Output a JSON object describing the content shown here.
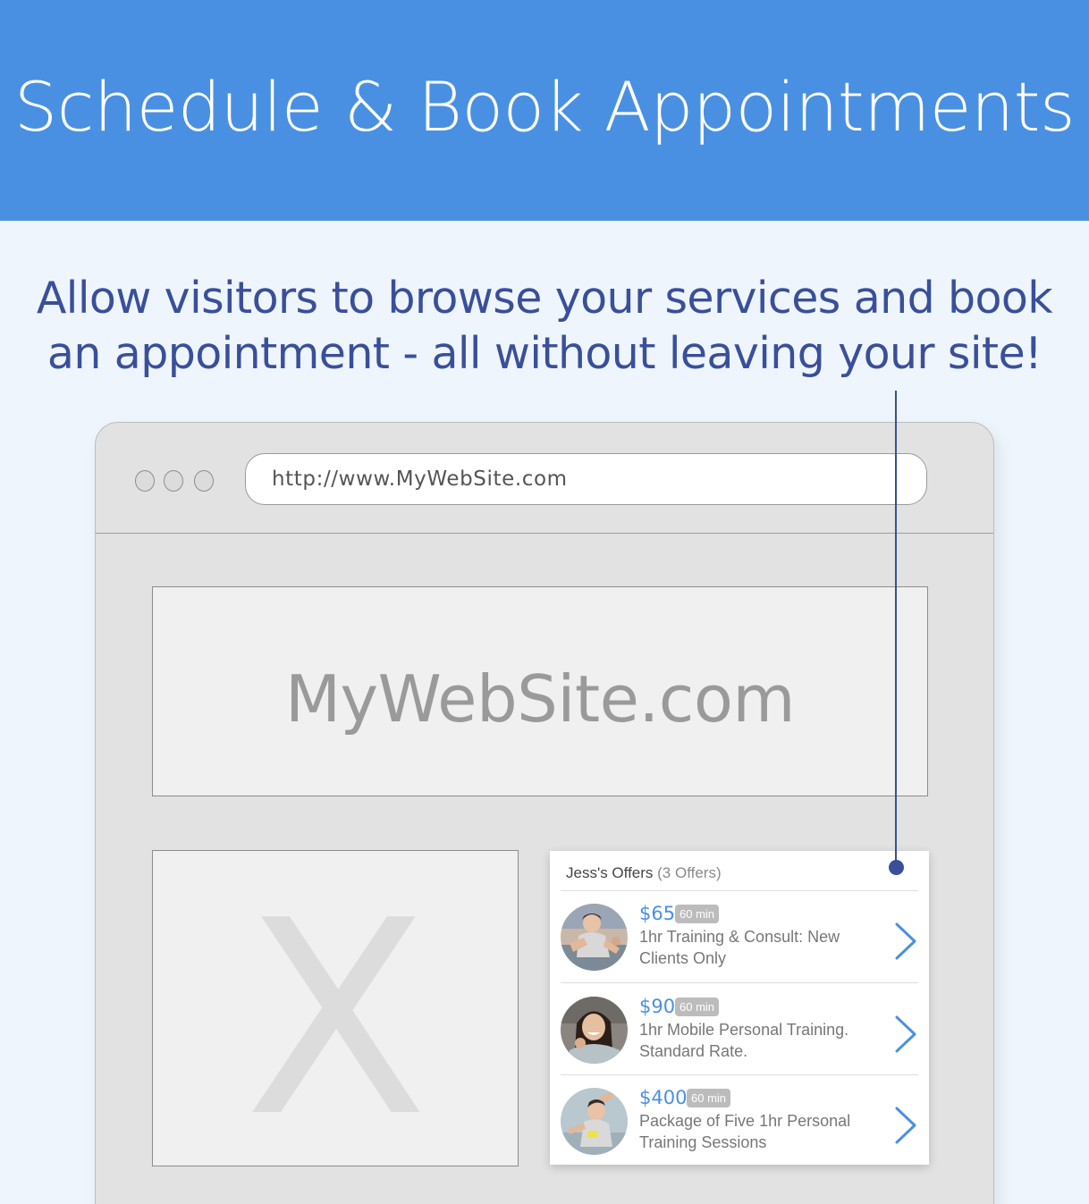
{
  "hero": {
    "title": "Schedule & Book Appointments"
  },
  "subtitle": {
    "line1": "Allow visitors to browse your services and book",
    "line2": "an appointment - all without leaving your site!"
  },
  "browser": {
    "url": "http://www.MyWebSite.com",
    "banner_text": "MyWebSite.com",
    "placeholder_glyph": "X"
  },
  "widget": {
    "title": "Jess's Offers",
    "count": "(3 Offers)",
    "offers": [
      {
        "price": "$65",
        "duration": "60 min",
        "description": "1hr Training & Consult: New Clients Only",
        "avatar": "woman-stretching-photo"
      },
      {
        "price": "$90",
        "duration": "60 min",
        "description": "1hr Mobile Personal Training. Standard Rate.",
        "avatar": "woman-smiling-photo"
      },
      {
        "price": "$400",
        "duration": "60 min",
        "description": "Package of Five 1hr Personal Training Sessions",
        "avatar": "woman-side-stretch-photo"
      }
    ]
  },
  "colors": {
    "hero_bg": "#4a90e2",
    "page_bg": "#eef5fd",
    "subtitle": "#3a4f9a",
    "price": "#4a90e2"
  }
}
